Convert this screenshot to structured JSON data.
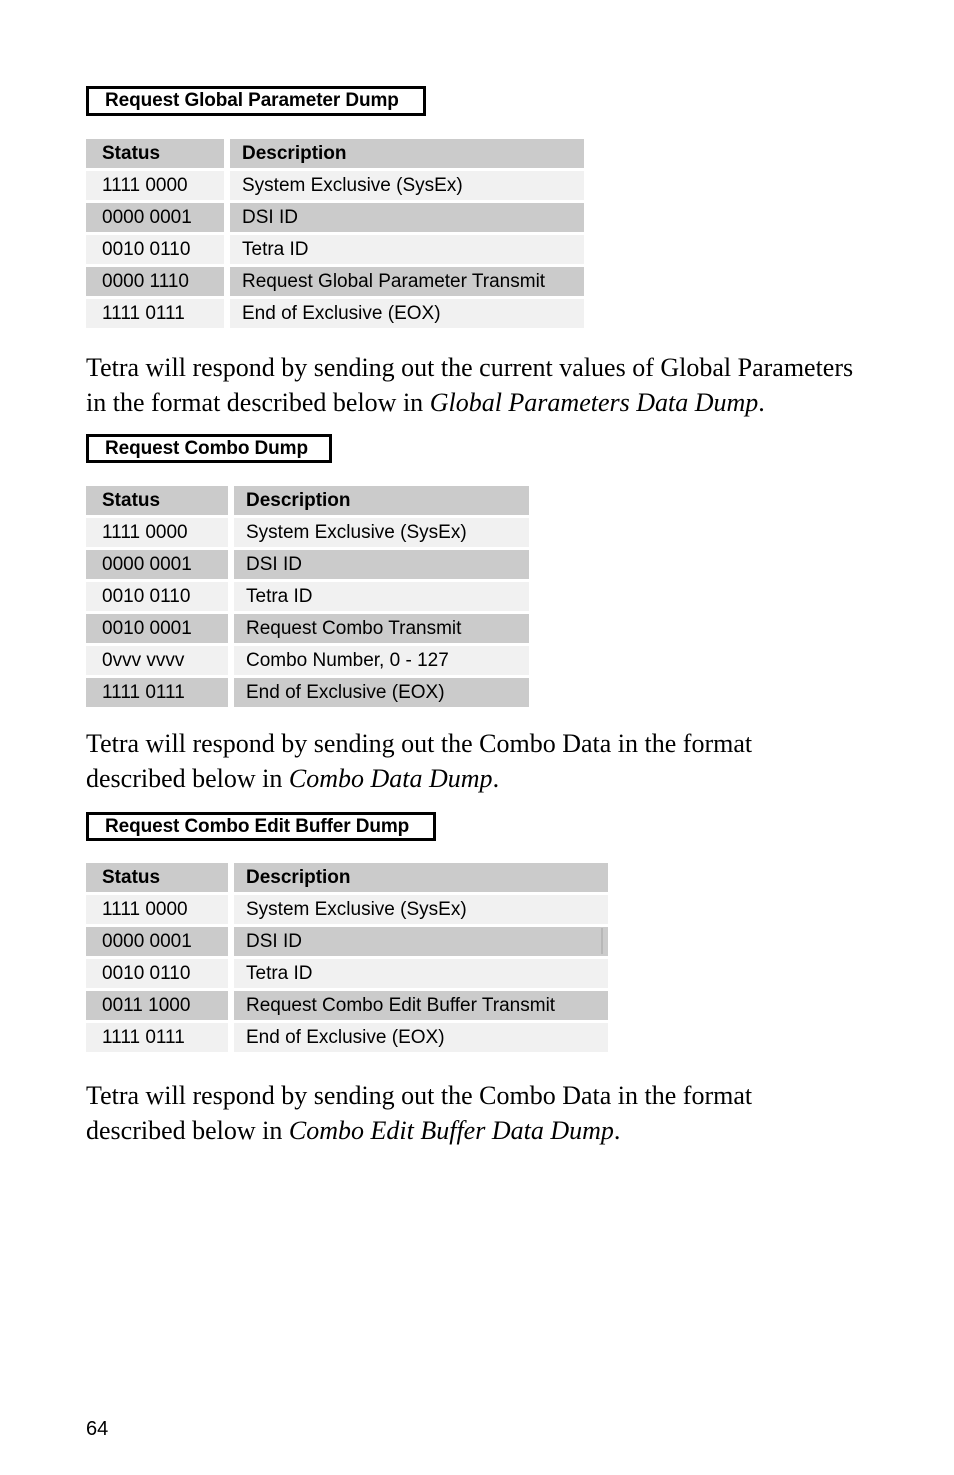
{
  "page": {
    "number": "64",
    "background_color": "#ffffff"
  },
  "style_colors": {
    "row_dark": "#cbcbcb",
    "row_light": "#f1f1f1",
    "text": "#000000",
    "border": "#000000"
  },
  "table_headers": {
    "status": "Status",
    "description": "Description"
  },
  "sections": [
    {
      "caption": "Request Global Parameter Dump",
      "table": {
        "columns": [
          "Status",
          "Description"
        ],
        "rows": [
          {
            "status": "1111 0000",
            "description": "System Exclusive (SysEx)"
          },
          {
            "status": "0000 0001",
            "description": "DSI ID"
          },
          {
            "status": "0010 0110",
            "description": "Tetra ID"
          },
          {
            "status": "0000 1110",
            "description": "Request Global Parameter Transmit"
          },
          {
            "status": "1111 0111",
            "description": "End of Exclusive (EOX)"
          }
        ]
      },
      "paragraph_prefix": "Tetra will respond by sending out the current values of Global Parameters in the format described below in ",
      "paragraph_italic": "Global Parameters Data Dump",
      "paragraph_suffix": "."
    },
    {
      "caption": "Request Combo Dump",
      "table": {
        "columns": [
          "Status",
          "Description"
        ],
        "rows": [
          {
            "status": "1111 0000",
            "description": "System Exclusive (SysEx)"
          },
          {
            "status": "0000 0001",
            "description": "DSI ID"
          },
          {
            "status": "0010 0110",
            "description": "Tetra ID"
          },
          {
            "status": "0010 0001",
            "description": "Request Combo Transmit"
          },
          {
            "status": "0vvv vvvv",
            "description": "Combo Number, 0 - 127"
          },
          {
            "status": "1111 0111",
            "description": "End of Exclusive (EOX)"
          }
        ]
      },
      "paragraph_prefix": "Tetra will respond by sending out the Combo Data in the format described below in ",
      "paragraph_italic": "Combo Data Dump",
      "paragraph_suffix": "."
    },
    {
      "caption": "Request Combo Edit Buffer Dump",
      "table": {
        "columns": [
          "Status",
          "Description"
        ],
        "rows": [
          {
            "status": "1111 0000",
            "description": "System Exclusive (SysEx)"
          },
          {
            "status": "0000 0001",
            "description": "DSI ID"
          },
          {
            "status": "0010 0110",
            "description": "Tetra ID"
          },
          {
            "status": "0011 1000",
            "description": "Request Combo Edit Buffer Transmit"
          },
          {
            "status": "1111 0111",
            "description": "End of Exclusive (EOX)"
          }
        ]
      },
      "paragraph_prefix": "Tetra will respond by sending out the Combo Data in the format described below in ",
      "paragraph_italic": "Combo Edit Buffer Data Dump",
      "paragraph_suffix": "."
    }
  ]
}
